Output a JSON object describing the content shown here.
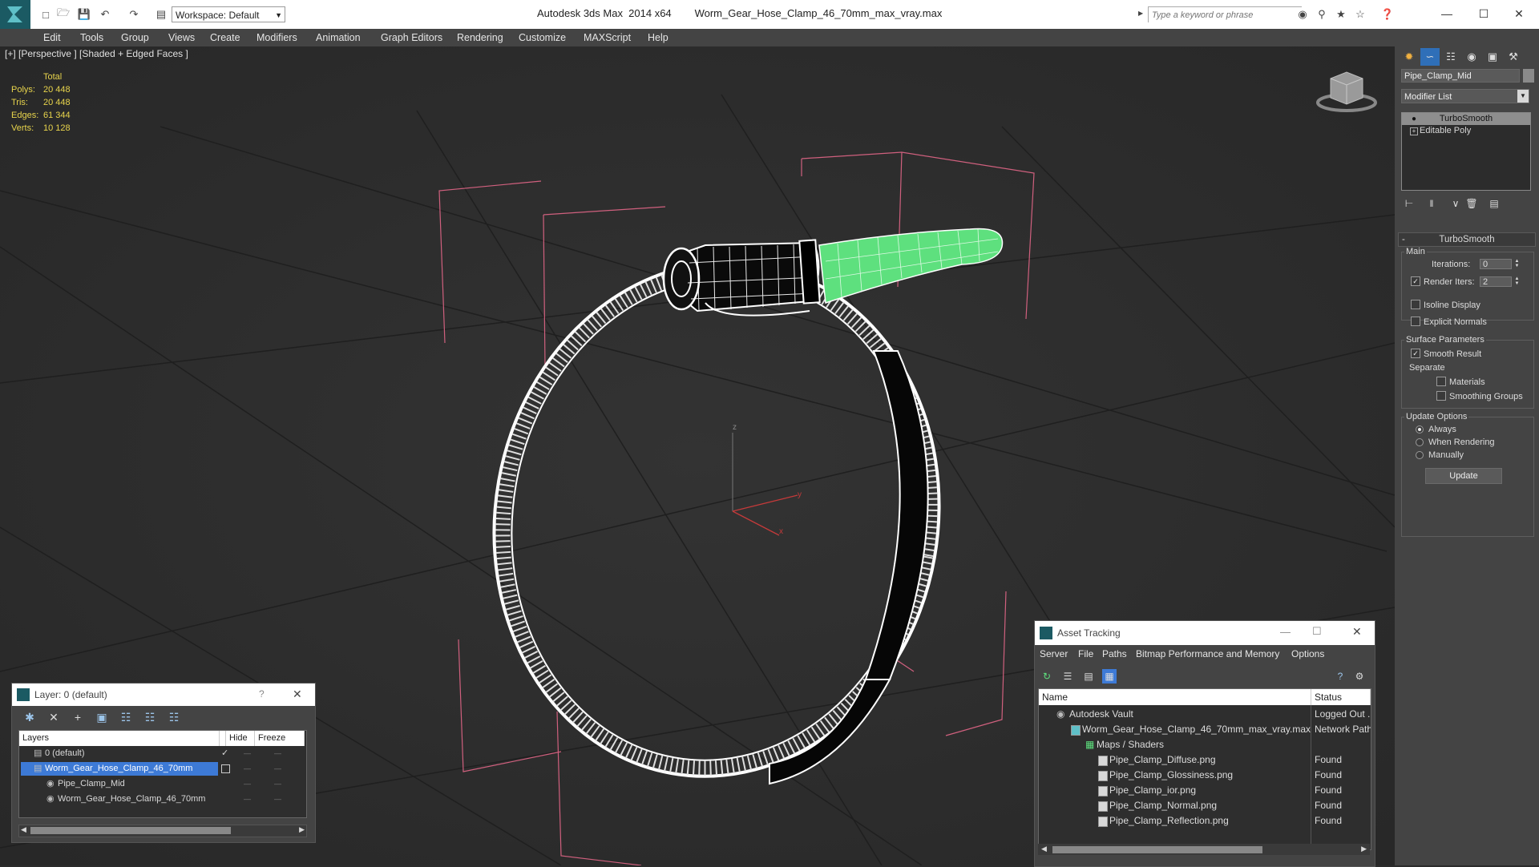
{
  "title": {
    "app": "Autodesk 3ds Max  2014 x64",
    "file": "Worm_Gear_Hose_Clamp_46_70mm_max_vray.max",
    "workspace": "Workspace: Default",
    "search_placeholder": "Type a keyword or phrase"
  },
  "menu": [
    "Edit",
    "Tools",
    "Group",
    "Views",
    "Create",
    "Modifiers",
    "Animation",
    "Graph Editors",
    "Rendering",
    "Customize",
    "MAXScript",
    "Help"
  ],
  "viewport": {
    "label": "[+] [Perspective ] [Shaded + Edged Faces ]",
    "stats_header": "Total",
    "stats": [
      {
        "label": "Polys:",
        "value": "20 448"
      },
      {
        "label": "Tris:",
        "value": "20 448"
      },
      {
        "label": "Edges:",
        "value": "61 344"
      },
      {
        "label": "Verts:",
        "value": "10 128"
      }
    ],
    "axis_labels": {
      "z": "z",
      "y": "y",
      "x": "x"
    }
  },
  "command_panel": {
    "object_name": "Pipe_Clamp_Mid",
    "modifier_list": "Modifier List",
    "stack": [
      "TurboSmooth",
      "Editable Poly"
    ],
    "rollout_title": "TurboSmooth",
    "main_group": "Main",
    "iterations_label": "Iterations:",
    "iterations_value": "0",
    "render_iters_label": "Render Iters:",
    "render_iters_value": "2",
    "render_iters_checked": true,
    "isoline_label": "Isoline Display",
    "explicit_normals_label": "Explicit Normals",
    "surface_group": "Surface Parameters",
    "smooth_result_label": "Smooth Result",
    "separate_label": "Separate",
    "materials_label": "Materials",
    "smoothing_groups_label": "Smoothing Groups",
    "update_group": "Update Options",
    "always_label": "Always",
    "when_rendering_label": "When Rendering",
    "manually_label": "Manually",
    "update_button": "Update"
  },
  "layer_dialog": {
    "title": "Layer: 0 (default)",
    "help": "?",
    "columns": [
      "Layers",
      "Hide",
      "Freeze"
    ],
    "rows": [
      {
        "name": "0 (default)",
        "selected": false
      },
      {
        "name": "Worm_Gear_Hose_Clamp_46_70mm",
        "selected": true
      },
      {
        "name": "Pipe_Clamp_Mid",
        "selected": false
      },
      {
        "name": "Worm_Gear_Hose_Clamp_46_70mm",
        "selected": false
      }
    ]
  },
  "asset_tracking": {
    "title": "Asset Tracking",
    "menu": [
      "Server",
      "File",
      "Paths",
      "Bitmap Performance and Memory",
      "Options"
    ],
    "columns": [
      "Name",
      "Status"
    ],
    "rows": [
      {
        "name": "Autodesk Vault",
        "status": "Logged Out ..."
      },
      {
        "name": "Worm_Gear_Hose_Clamp_46_70mm_max_vray.max",
        "status": "Network Path"
      },
      {
        "name": "Maps / Shaders",
        "status": ""
      },
      {
        "name": "Pipe_Clamp_Diffuse.png",
        "status": "Found"
      },
      {
        "name": "Pipe_Clamp_Glossiness.png",
        "status": "Found"
      },
      {
        "name": "Pipe_Clamp_ior.png",
        "status": "Found"
      },
      {
        "name": "Pipe_Clamp_Normal.png",
        "status": "Found"
      },
      {
        "name": "Pipe_Clamp_Reflection.png",
        "status": "Found"
      }
    ]
  },
  "colors": {
    "selected_green": "#5ee07e",
    "stats_yellow": "#e8d44c",
    "selection_blue": "#3d7ad6",
    "bbox_pink": "#d0607e"
  }
}
